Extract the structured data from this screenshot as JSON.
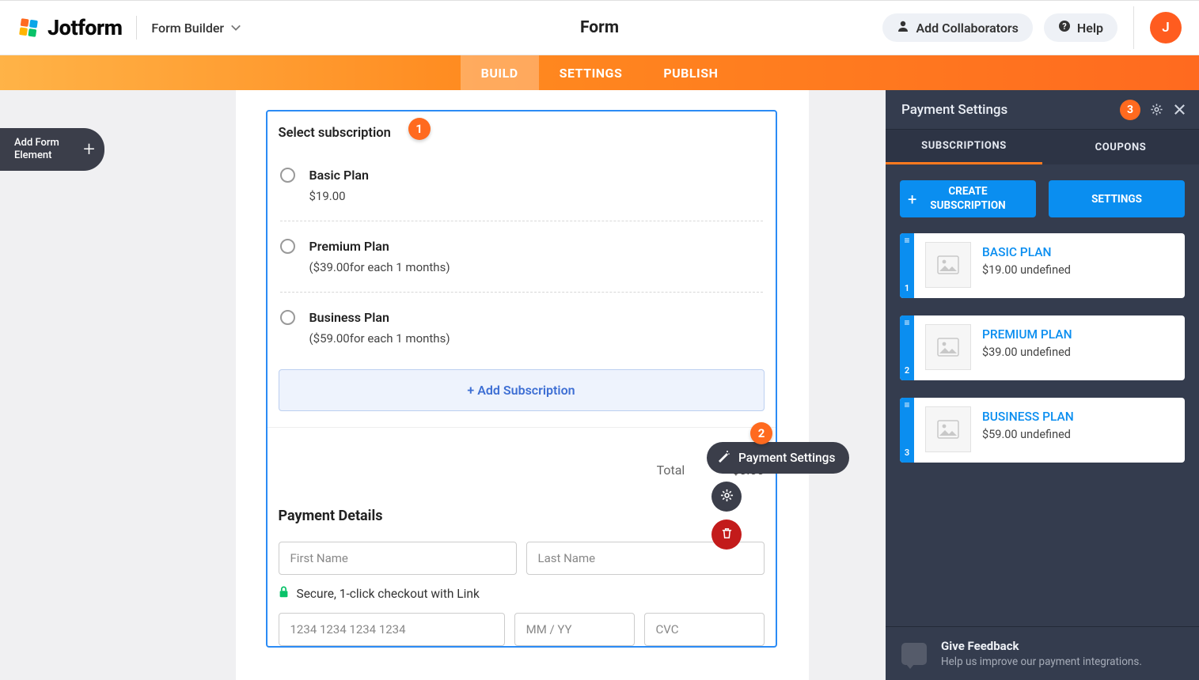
{
  "header": {
    "brand": "Jotform",
    "mode": "Form Builder",
    "title": "Form",
    "collab": "Add Collaborators",
    "help": "Help",
    "avatar_initial": "J"
  },
  "tabs": {
    "build": "BUILD",
    "settings": "SETTINGS",
    "publish": "PUBLISH"
  },
  "addElement": "Add Form Element",
  "badges": {
    "b1": "1",
    "b2": "2",
    "b3": "3"
  },
  "form": {
    "section_title": "Select subscription",
    "plans": [
      {
        "name": "Basic Plan",
        "price": "$19.00"
      },
      {
        "name": "Premium Plan",
        "price": "($39.00for each 1 months)"
      },
      {
        "name": "Business Plan",
        "price": "($59.00for each 1 months)"
      }
    ],
    "add_subscription": "+ Add Subscription",
    "total_label": "Total",
    "total_value": "$0.00",
    "payment_details_heading": "Payment Details",
    "first_name_ph": "First Name",
    "last_name_ph": "Last Name",
    "secure_text": "Secure, 1-click checkout with Link",
    "card_ph": "1234 1234 1234 1234",
    "exp_ph": "MM / YY",
    "cvc_ph": "CVC"
  },
  "float": {
    "ps_label": "Payment Settings"
  },
  "rightPanel": {
    "title": "Payment Settings",
    "tab_subscriptions": "SUBSCRIPTIONS",
    "tab_coupons": "COUPONS",
    "create_btn": "CREATE SUBSCRIPTION",
    "settings_btn": "SETTINGS",
    "items": [
      {
        "idx": "1",
        "name": "BASIC PLAN",
        "price": "$19.00 undefined"
      },
      {
        "idx": "2",
        "name": "PREMIUM PLAN",
        "price": "$39.00 undefined"
      },
      {
        "idx": "3",
        "name": "BUSINESS PLAN",
        "price": "$59.00 undefined"
      }
    ],
    "feedback_title": "Give Feedback",
    "feedback_sub": "Help us improve our payment integrations."
  }
}
